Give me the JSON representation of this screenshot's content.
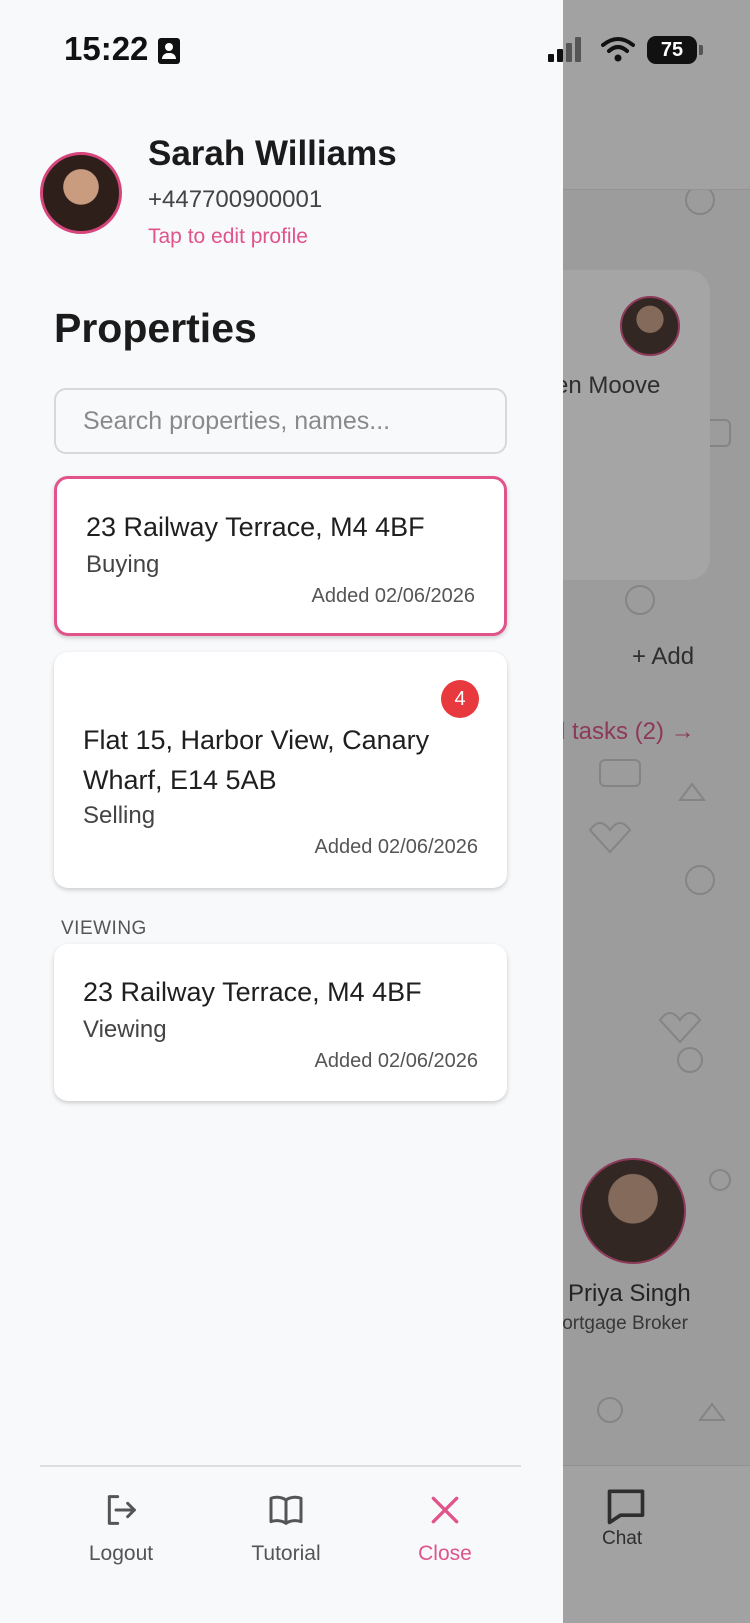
{
  "status_bar": {
    "time": "15:22",
    "battery": "75"
  },
  "profile": {
    "name": "Sarah Williams",
    "phone": "+447700900001",
    "edit_link": "Tap to edit profile"
  },
  "properties": {
    "title": "Properties",
    "search_placeholder": "Search properties, names...",
    "items": [
      {
        "address": "23 Railway Terrace, M4 4BF",
        "status": "Buying",
        "added": "Added 02/06/2026",
        "selected": true
      },
      {
        "address": "Flat 15, Harbor View, Canary Wharf, E14 5AB",
        "status": "Selling",
        "added": "Added 02/06/2026",
        "badge": "4"
      }
    ],
    "viewing_group_label": "VIEWING",
    "viewing_items": [
      {
        "address": "23 Railway Terrace, M4 4BF",
        "status": "Viewing",
        "added": "Added 02/06/2026"
      }
    ]
  },
  "footer": {
    "logout_label": "Logout",
    "tutorial_label": "Tutorial",
    "close_label": "Close"
  },
  "background": {
    "card_name_fragment": "en Moove",
    "add_label": "+ Add",
    "tasks_fragment": "l tasks (2) →",
    "contact_name": "Priya Singh",
    "contact_role_fragment": "lortgage Broker",
    "chat_label": "Chat"
  },
  "colors": {
    "accent": "#e0548b",
    "badge": "#e8393f",
    "text": "#1b1b1b"
  }
}
